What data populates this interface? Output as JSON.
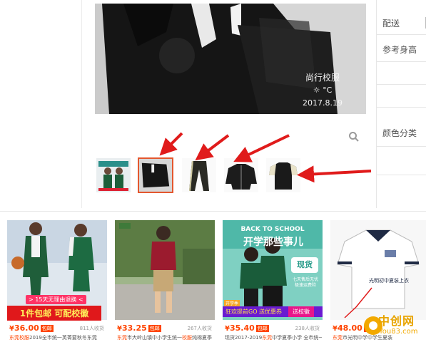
{
  "photo": {
    "watermark_brand": "尚行校服",
    "watermark_temp": "°C",
    "watermark_date": "2017.8.19"
  },
  "sidebar": {
    "delivery_label": "配送",
    "height_label": "参考身高",
    "color_label": "颜色分类"
  },
  "thumbnails": [
    "main-uniform",
    "black-jacket",
    "pants",
    "sport-jacket",
    "polo-shirt"
  ],
  "products": [
    {
      "banner_top": "> 15天无理由退换 <",
      "banner_main": "1件包邮 可配校徽",
      "price_symbol": "¥",
      "price": "36.00",
      "tag": "包邮",
      "sales": "811人收货",
      "title_highlight": "东莞校服",
      "title_rest": "2019全市统一英菁要秋冬东莞"
    },
    {
      "price_symbol": "¥",
      "price": "33.25",
      "tag": "包邮",
      "sales": "267人收货",
      "title_highlight": "东莞",
      "title_mid": "市大岭山镇中小学生统一",
      "title_highlight2": "校服",
      "title_rest": "纯棉夏季"
    },
    {
      "header": "BACK TO SCHOOL",
      "slogan": "开学那些事儿",
      "badge": "现货",
      "badge_sub": "七天售后无忧",
      "badge_sub2": "极速运费险",
      "corner": "开学季",
      "promo_left": "狂欢提前GO 送优惠券",
      "promo_right": "送校徽",
      "price_symbol": "¥",
      "price": "35.40",
      "tag": "包邮",
      "sales": "238人收货",
      "title_pre": "现货2017-2019",
      "title_highlight": "东莞",
      "title_rest": "中学夏季小学 全市统一"
    },
    {
      "shirt_text": "光明初中夏装上衣",
      "price_symbol": "¥",
      "price": "48.00",
      "tag": "包邮",
      "title_highlight": "东莞",
      "title_rest": "市光明中学中学生夏装"
    }
  ],
  "logo": {
    "cn": "中创网",
    "en": "You83.com"
  }
}
